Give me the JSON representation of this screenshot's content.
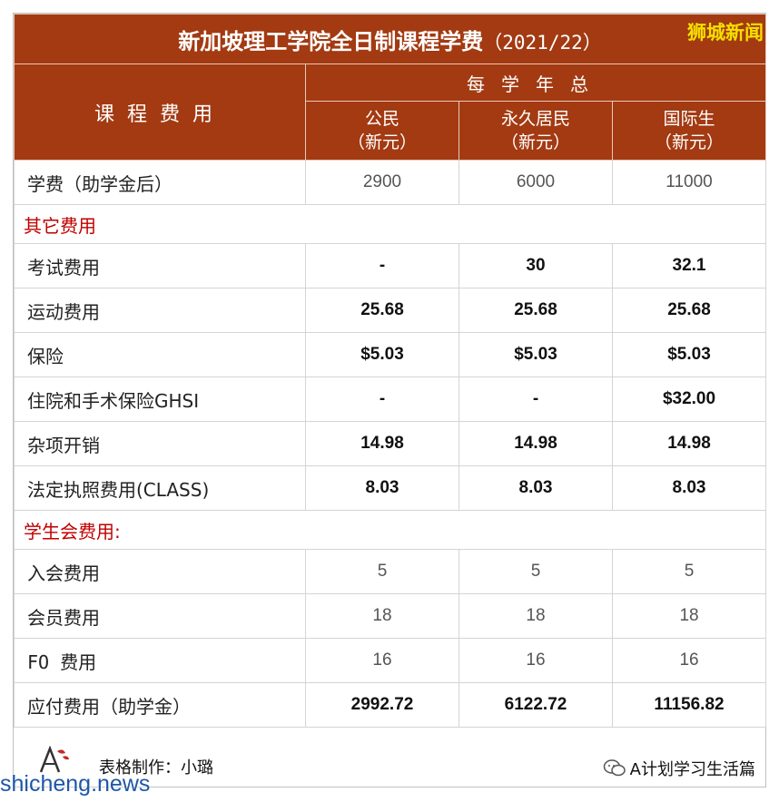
{
  "title": {
    "main": "新加坡理工学院全日制课程学费",
    "year": "（2021/22）",
    "brand": "狮城新闻"
  },
  "header": {
    "left": "课程费用",
    "span": "每学年总",
    "columns": [
      {
        "line1": "公民",
        "line2": "（新元）"
      },
      {
        "line1": "永久居民",
        "line2": "（新元）"
      },
      {
        "line1": "国际生",
        "line2": "（新元）"
      }
    ]
  },
  "tuition": {
    "label": "学费（助学金后）",
    "values": [
      "2900",
      "6000",
      "11000"
    ]
  },
  "other_fees": {
    "heading": "其它费用",
    "rows": [
      {
        "label": "考试费用",
        "values": [
          "-",
          "30",
          "32.1"
        ]
      },
      {
        "label": "运动费用",
        "values": [
          "25.68",
          "25.68",
          "25.68"
        ]
      },
      {
        "label": "保险",
        "values": [
          "$5.03",
          "$5.03",
          "$5.03"
        ]
      },
      {
        "label": "住院和手术保险GHSI",
        "values": [
          "-",
          "-",
          "$32.00"
        ]
      },
      {
        "label": "杂项开销",
        "values": [
          "14.98",
          "14.98",
          "14.98"
        ]
      },
      {
        "label": "法定执照费用(CLASS)",
        "values": [
          "8.03",
          "8.03",
          "8.03"
        ]
      }
    ]
  },
  "union_fees": {
    "heading": "学生会费用:",
    "rows": [
      {
        "label": "入会费用",
        "values": [
          "5",
          "5",
          "5"
        ]
      },
      {
        "label": "会员费用",
        "values": [
          "18",
          "18",
          "18"
        ]
      },
      {
        "label": "FO 费用",
        "values": [
          "16",
          "16",
          "16"
        ]
      }
    ]
  },
  "total": {
    "label": "应付费用（助学金）",
    "values": [
      "2992.72",
      "6122.72",
      "11156.82"
    ]
  },
  "footer": {
    "author": "表格制作：小璐",
    "wechat": "A计划学习生活篇",
    "watermark": "shicheng.news"
  },
  "colors": {
    "header_bg": "#a33a12",
    "section_text": "#c00000",
    "brand_text": "#f3e000",
    "watermark": "#1e56a8"
  }
}
